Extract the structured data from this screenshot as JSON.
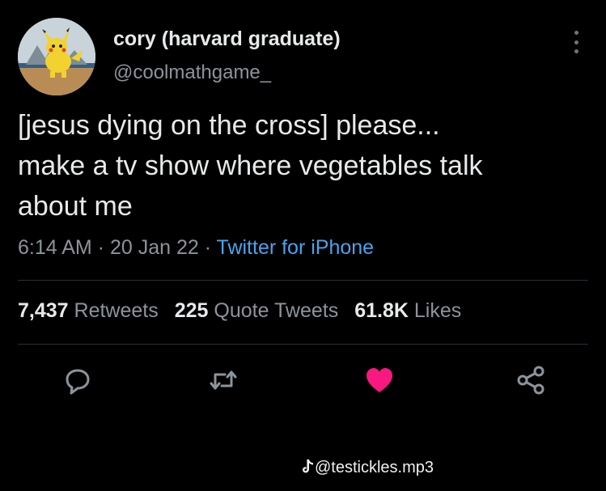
{
  "tweet": {
    "display_name": "cory (harvard graduate)",
    "handle": "@coolmathgame_",
    "text_line1": "[jesus dying on the cross] please...",
    "text_line2": "make a tv show where vegetables talk",
    "text_line3": "about me",
    "time": "6:14 AM",
    "date": "20 Jan 22",
    "source": "Twitter for iPhone",
    "separator": " · "
  },
  "stats": {
    "retweets_count": "7,437",
    "retweets_label": "Retweets",
    "quotes_count": "225",
    "quotes_label": "Quote Tweets",
    "likes_count": "61.8K",
    "likes_label": "Likes"
  },
  "actions": {
    "reply_icon": "reply-icon",
    "retweet_icon": "retweet-icon",
    "like_icon": "heart-filled-icon",
    "share_icon": "share-icon"
  },
  "colors": {
    "background": "#000000",
    "text": "#e7e9ea",
    "muted": "#8b949a",
    "link": "#4aa3ec",
    "like": "#f91880"
  },
  "watermark": {
    "icon": "tiktok-icon",
    "text": "@testickles.mp3"
  }
}
